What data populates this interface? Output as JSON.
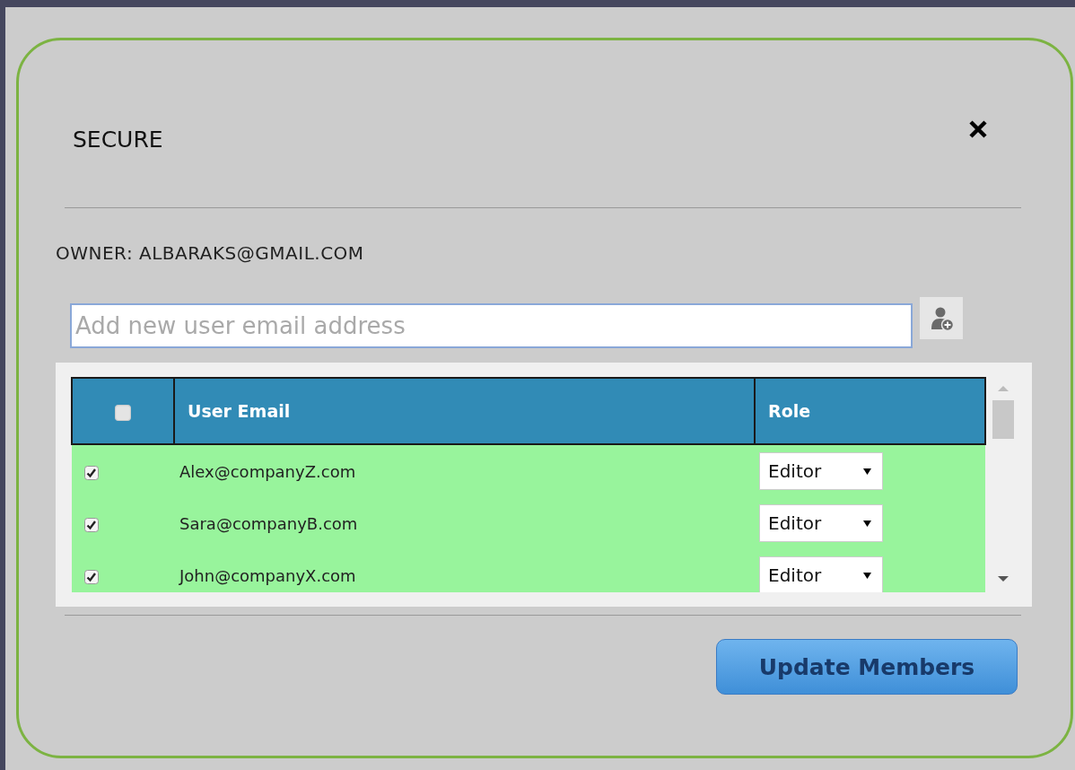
{
  "dialog": {
    "title": "SECURE",
    "owner": "OWNER: ALBARAKS@GMAIL.COM",
    "new_user_field": {
      "placeholder": "Add new user email address"
    },
    "table": {
      "select_all": {
        "checked": false
      },
      "columns": [
        "User Email",
        "Role"
      ],
      "rows": [
        {
          "checked": true,
          "email": "Alex@companyZ.com",
          "role": "Editor"
        },
        {
          "checked": true,
          "email": "Sara@companyB.com",
          "role": "Editor"
        },
        {
          "checked": true,
          "email": "John@companyX.com",
          "role": "Editor"
        }
      ]
    },
    "buttons": [
      "Update Members"
    ]
  }
}
